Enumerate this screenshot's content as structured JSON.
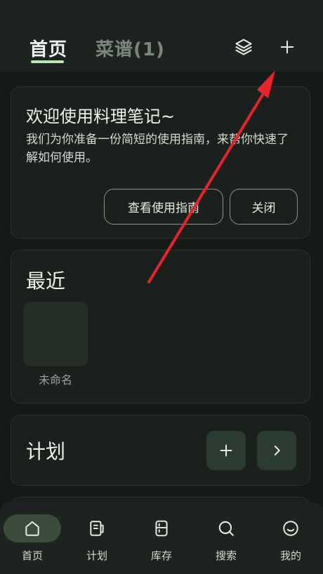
{
  "header": {
    "tabs": [
      {
        "label": "首页",
        "active": true
      },
      {
        "label": "菜谱(1)",
        "active": false
      }
    ],
    "icons": [
      "layers-icon",
      "plus-icon"
    ]
  },
  "welcome": {
    "title": "欢迎使用料理笔记~",
    "description": "我们为你准备一份简短的使用指南，来帮你快速了解如何使用。",
    "guide_button": "查看使用指南",
    "close_button": "关闭"
  },
  "recent": {
    "title": "最近",
    "items": [
      {
        "label": "未命名"
      }
    ]
  },
  "plan": {
    "title": "计划"
  },
  "nav": {
    "items": [
      {
        "label": "首页",
        "icon": "home-icon",
        "active": true
      },
      {
        "label": "计划",
        "icon": "planner-icon",
        "active": false
      },
      {
        "label": "库存",
        "icon": "fridge-icon",
        "active": false
      },
      {
        "label": "搜索",
        "icon": "search-icon",
        "active": false
      },
      {
        "label": "我的",
        "icon": "smile-icon",
        "active": false
      }
    ]
  },
  "colors": {
    "background": "#141a15",
    "surface": "#1a211c",
    "accent": "#bde3b3",
    "annotation_arrow": "#e8232b"
  }
}
